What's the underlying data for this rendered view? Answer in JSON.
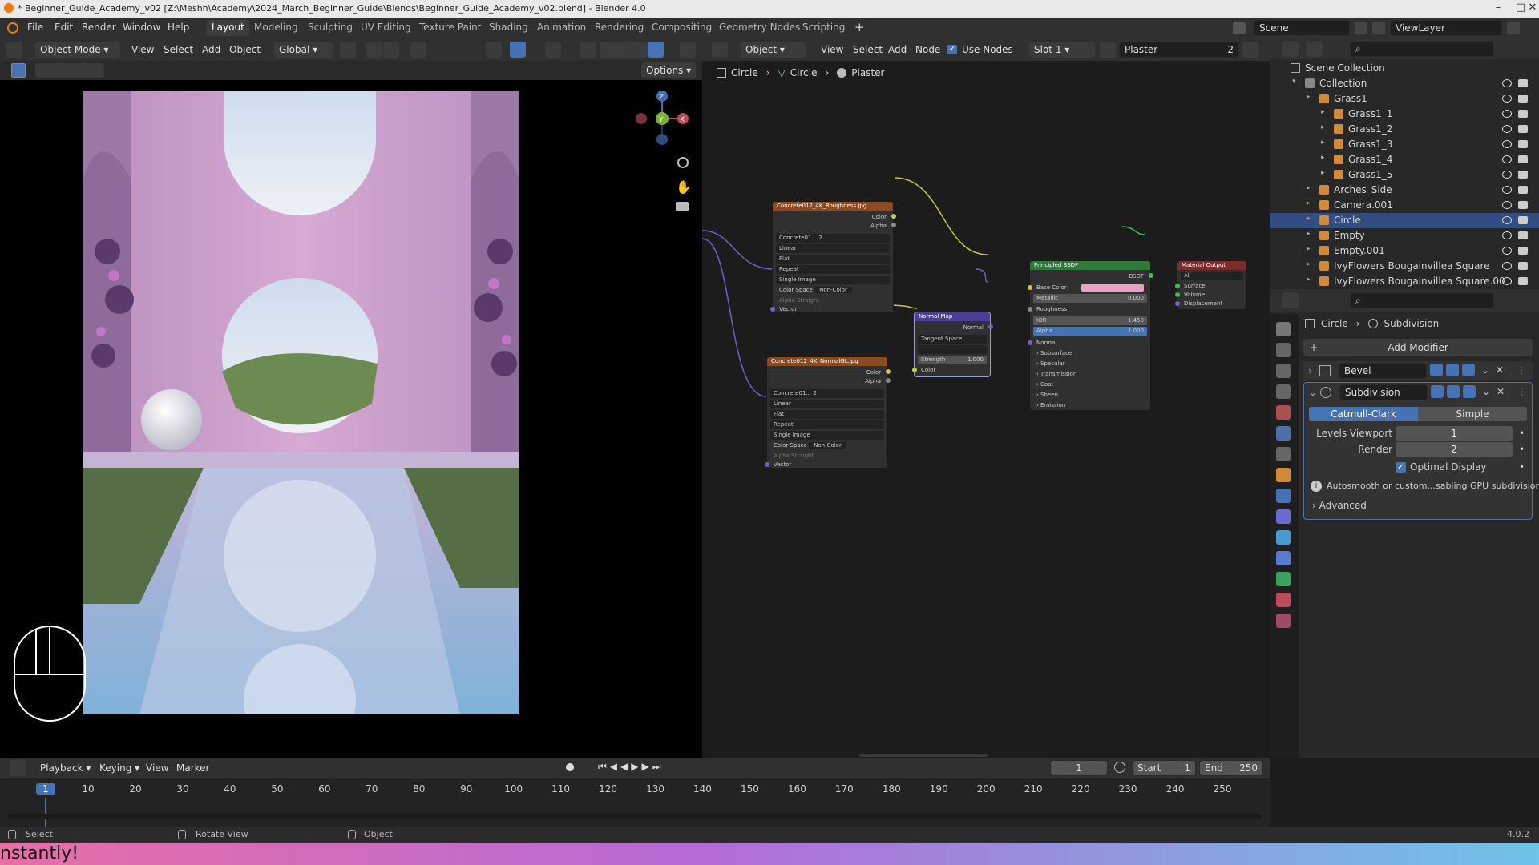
{
  "window": {
    "title": "* Beginner_Guide_Academy_v02 [Z:\\Meshh\\Academy\\2024_March_Beginner_Guide\\Blends\\Beginner_Guide_Academy_v02.blend] - Blender 4.0"
  },
  "menubar": {
    "items": [
      "File",
      "Edit",
      "Render",
      "Window",
      "Help"
    ],
    "workspaces": [
      "Layout",
      "Modeling",
      "Sculpting",
      "UV Editing",
      "Texture Paint",
      "Shading",
      "Animation",
      "Rendering",
      "Compositing",
      "Geometry Nodes",
      "Scripting"
    ],
    "active_workspace": "Layout",
    "scene": "Scene",
    "view_layer": "ViewLayer"
  },
  "viewport": {
    "mode": "Object Mode",
    "menus": [
      "View",
      "Select",
      "Add",
      "Object"
    ],
    "orientation": "Global",
    "options_label": "Options",
    "gizmo_axes": [
      "X",
      "Y",
      "Z"
    ]
  },
  "node_editor": {
    "object_label": "Object",
    "menus": [
      "View",
      "Select",
      "Add",
      "Node"
    ],
    "use_nodes_label": "Use Nodes",
    "slot": "Slot 1",
    "material": "Plaster",
    "material_users": "2",
    "breadcrumb": [
      "Circle",
      "Circle",
      "Plaster"
    ],
    "nodes": {
      "roughness_tex": {
        "title": "Concrete012_4K_Roughness.jpg",
        "image": "Concrete01...",
        "users": "2",
        "outputs": [
          "Color",
          "Alpha"
        ],
        "interpolation": "Linear",
        "projection": "Flat",
        "extension": "Repeat",
        "source": "Single Image",
        "color_space_label": "Color Space",
        "color_space": "Non-Color",
        "alpha_label": "Alpha",
        "alpha_mode": "Straight",
        "input": "Vector"
      },
      "normal_tex": {
        "title": "Concrete012_4K_NormalGL.jpg",
        "image": "Concrete01...",
        "users": "2",
        "outputs": [
          "Color",
          "Alpha"
        ],
        "interpolation": "Linear",
        "projection": "Flat",
        "extension": "Repeat",
        "source": "Single Image",
        "color_space_label": "Color Space",
        "color_space": "Non-Color",
        "alpha_label": "Alpha",
        "alpha_mode": "Straight",
        "input": "Vector"
      },
      "normal_map": {
        "title": "Normal Map",
        "output": "Normal",
        "space": "Tangent Space",
        "strength_label": "Strength",
        "strength": "1.000",
        "input": "Color"
      },
      "bsdf": {
        "title": "Principled BSDF",
        "output": "BSDF",
        "base_color_label": "Base Color",
        "base_color": "#e8a3c0",
        "metallic_label": "Metallic",
        "metallic": "0.000",
        "roughness_label": "Roughness",
        "ior_label": "IOR",
        "ior": "1.450",
        "alpha_label": "Alpha",
        "alpha": "1.000",
        "normal_label": "Normal",
        "panels": [
          "Subsurface",
          "Specular",
          "Transmission",
          "Coat",
          "Sheen",
          "Emission"
        ]
      },
      "output": {
        "title": "Material Output",
        "target": "All",
        "inputs": [
          "Surface",
          "Volume",
          "Displacement"
        ]
      }
    }
  },
  "outliner": {
    "root": "Scene Collection",
    "rows": [
      {
        "label": "Collection",
        "indent": 1
      },
      {
        "label": "Grass1",
        "indent": 2
      },
      {
        "label": "Grass1_1",
        "indent": 3
      },
      {
        "label": "Grass1_2",
        "indent": 3
      },
      {
        "label": "Grass1_3",
        "indent": 3
      },
      {
        "label": "Grass1_4",
        "indent": 3
      },
      {
        "label": "Grass1_5",
        "indent": 3
      },
      {
        "label": "Arches_Side",
        "indent": 2
      },
      {
        "label": "Camera.001",
        "indent": 2
      },
      {
        "label": "Circle",
        "indent": 2,
        "selected": true
      },
      {
        "label": "Empty",
        "indent": 2
      },
      {
        "label": "Empty.001",
        "indent": 2
      },
      {
        "label": "IvyFlowers Bougainvillea Square",
        "indent": 2
      },
      {
        "label": "IvyFlowers Bougainvillea Square.00",
        "indent": 2
      }
    ]
  },
  "properties": {
    "breadcrumb": [
      "Circle",
      "Subdivision"
    ],
    "add_modifier": "Add Modifier",
    "modifiers": [
      {
        "name": "Bevel",
        "expanded": false
      },
      {
        "name": "Subdivision",
        "expanded": true
      }
    ],
    "subdivision": {
      "types": [
        "Catmull-Clark",
        "Simple"
      ],
      "active_type": "Catmull-Clark",
      "levels_viewport_label": "Levels Viewport",
      "levels_viewport": "1",
      "render_label": "Render",
      "render": "2",
      "optimal_display_label": "Optimal Display",
      "optimal_display": true,
      "info": "Autosmooth or custom...sabling GPU subdivision",
      "advanced": "Advanced"
    }
  },
  "timeline": {
    "menus": [
      "Playback",
      "Keying",
      "View",
      "Marker"
    ],
    "current_frame": "1",
    "start_label": "Start",
    "start": "1",
    "end_label": "End",
    "end": "250",
    "ticks": [
      "1",
      "10",
      "20",
      "30",
      "40",
      "50",
      "60",
      "70",
      "80",
      "90",
      "100",
      "110",
      "120",
      "130",
      "140",
      "150",
      "160",
      "170",
      "180",
      "190",
      "200",
      "210",
      "220",
      "230",
      "240",
      "250"
    ]
  },
  "statusbar": {
    "select": "Select",
    "rotate": "Rotate View",
    "object": "Object",
    "version": "4.0.2"
  },
  "banner": {
    "text": "nstantly!"
  },
  "colors": {
    "accent": "#4772b3",
    "selection": "#334d80",
    "texture_header": "#8a4b22",
    "shader_header": "#2f7a3a",
    "vector_header": "#4a3f99",
    "output_header": "#7a2d2d"
  }
}
